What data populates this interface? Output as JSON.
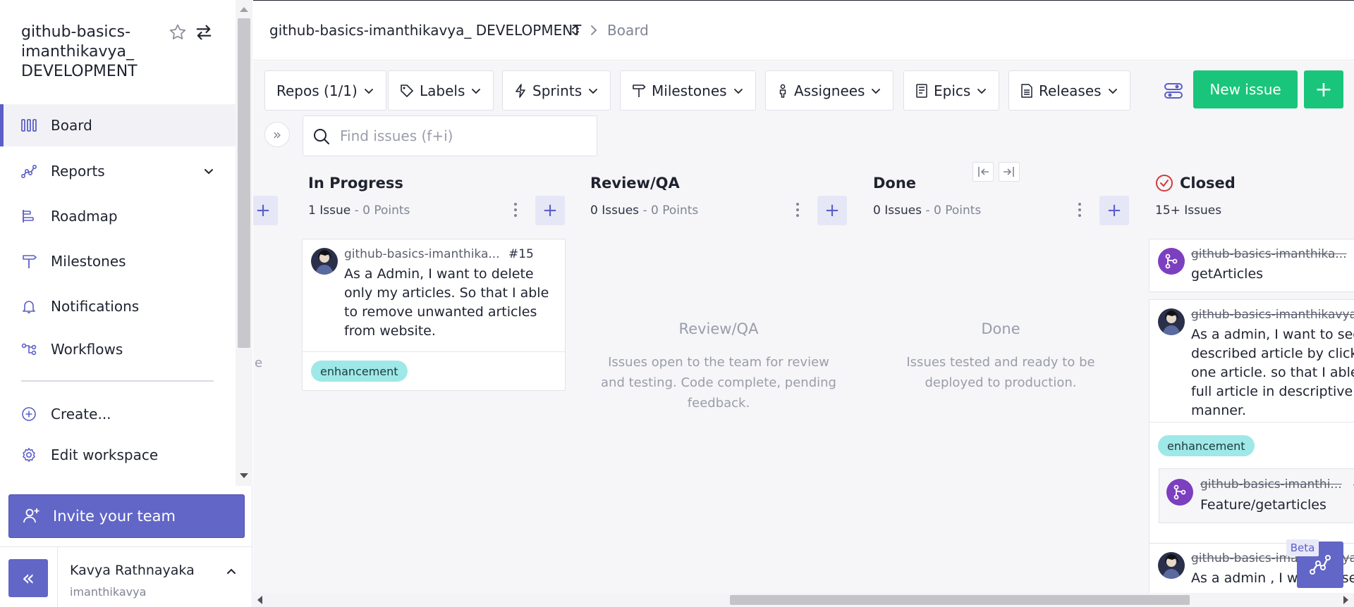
{
  "sidebar": {
    "workspace_title": "github-basics-imanthikavya_ DEVELOPMENT",
    "items": [
      {
        "label": "Board",
        "icon": "board-columns-icon"
      },
      {
        "label": "Reports",
        "icon": "reports-graph-icon"
      },
      {
        "label": "Roadmap",
        "icon": "roadmap-icon"
      },
      {
        "label": "Milestones",
        "icon": "milestone-signpost-icon"
      },
      {
        "label": "Notifications",
        "icon": "bell-icon"
      },
      {
        "label": "Workflows",
        "icon": "workflow-icon"
      },
      {
        "label": "Create...",
        "icon": "plus-circle-icon"
      },
      {
        "label": "Edit workspace",
        "icon": "gear-icon"
      }
    ],
    "invite_label": "Invite your team",
    "user": {
      "name": "Kavya Rathnayaka",
      "handle": "imanthikavya"
    },
    "collapse_label": "«"
  },
  "header": {
    "workspace_crumb": "github-basics-imanthikavya_ DEVELOPMENT",
    "current_crumb": "Board"
  },
  "toolbar": {
    "filters": [
      {
        "label": "Repos (1/1)",
        "icon": ""
      },
      {
        "label": "Labels",
        "icon": "tag-icon"
      },
      {
        "label": "Sprints",
        "icon": "lightning-icon"
      },
      {
        "label": "Milestones",
        "icon": "signpost-icon"
      },
      {
        "label": "Assignees",
        "icon": "person-icon"
      },
      {
        "label": "Epics",
        "icon": "epic-icon"
      },
      {
        "label": "Releases",
        "icon": "document-icon"
      }
    ],
    "new_issue_label": "New issue",
    "plus_label": "+",
    "expand_label": "»"
  },
  "search": {
    "placeholder": "Find issues (f+i)"
  },
  "board": {
    "partial_left_column_fragment": "e",
    "columns": [
      {
        "title": "In Progress",
        "issues_count": "1 Issue",
        "points": " - 0 Points",
        "cards": [
          {
            "repo": "github-basics-imanthika...",
            "number": "#15",
            "text": "As a Admin, I want to delete only my articles. So that I able to remove unwanted articles from website.",
            "label": "enhancement"
          }
        ]
      },
      {
        "title": "Review/QA",
        "issues_count": "0 Issues",
        "points": " - 0 Points",
        "empty_title": "Review/QA",
        "empty_desc": "Issues open to the team for review and testing. Code complete, pending feedback."
      },
      {
        "title": "Done",
        "issues_count": "0 Issues",
        "points": " - 0 Points",
        "empty_title": "Done",
        "empty_desc": "Issues tested and ready to be deployed to production."
      },
      {
        "title": "Closed",
        "issues_count": "15+ Issues",
        "cards": [
          {
            "repo": "github-basics-imanthika...",
            "text": "getArticles",
            "type": "pull-request"
          },
          {
            "repo": "github-basics-imanthikavya",
            "text": "As a admin, I want to see described article by click one article. so that I able full article in descriptive manner.",
            "label": "enhancement",
            "linked_pr": {
              "repo": "github-basics-imanthi...",
              "number": "#",
              "text": "Feature/getarticles"
            }
          },
          {
            "repo": "github-basics-imanthikavya",
            "text": "As a admin , I want to se"
          }
        ]
      }
    ]
  },
  "beta_label": "Beta",
  "colors": {
    "accent": "#6266c6",
    "primary_green": "#19c57a",
    "label_bg": "#9fe8e8",
    "pr_purple": "#7b3fbf"
  }
}
